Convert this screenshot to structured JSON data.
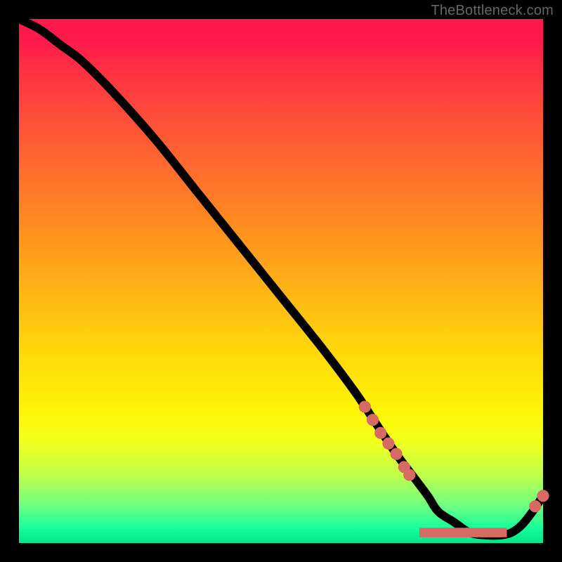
{
  "watermark": "TheBottleneck.com",
  "colors": {
    "marker": "#d76b63",
    "line": "#000000"
  },
  "chart_data": {
    "type": "line",
    "title": "",
    "xlabel": "",
    "ylabel": "",
    "xlim": [
      0,
      100
    ],
    "ylim": [
      0,
      100
    ],
    "series": [
      {
        "name": "bottleneck-curve",
        "x": [
          0,
          4,
          8,
          12,
          18,
          26,
          34,
          42,
          50,
          58,
          64,
          68,
          72,
          75,
          78,
          80,
          83,
          86,
          89,
          92,
          94,
          96,
          98,
          100
        ],
        "y": [
          100,
          98,
          95,
          92,
          86,
          77,
          67,
          57,
          47,
          37,
          29,
          23,
          17,
          13,
          9,
          6,
          4,
          2,
          1.5,
          1.5,
          2,
          3.5,
          6,
          9
        ]
      }
    ],
    "highlight_markers": {
      "name": "descent-markers",
      "points": [
        {
          "x": 66,
          "y": 26
        },
        {
          "x": 67.5,
          "y": 23.5
        },
        {
          "x": 69,
          "y": 21
        },
        {
          "x": 70.5,
          "y": 19
        },
        {
          "x": 72,
          "y": 17
        },
        {
          "x": 73.5,
          "y": 14.5
        },
        {
          "x": 74.5,
          "y": 13
        }
      ]
    },
    "barcode_cluster": {
      "name": "bottom-cluster",
      "label": "",
      "y": 2,
      "x_ticks": [
        77.5,
        78.5,
        79.5,
        80.5,
        81.5,
        82.5,
        83.5,
        84.5,
        85.5,
        86.5,
        88.0,
        89.0,
        90.0,
        91.0,
        92.0
      ],
      "label_center_x": 83
    },
    "end_markers": {
      "name": "tail-markers",
      "points": [
        {
          "x": 98.5,
          "y": 7
        },
        {
          "x": 100,
          "y": 9
        }
      ]
    }
  }
}
